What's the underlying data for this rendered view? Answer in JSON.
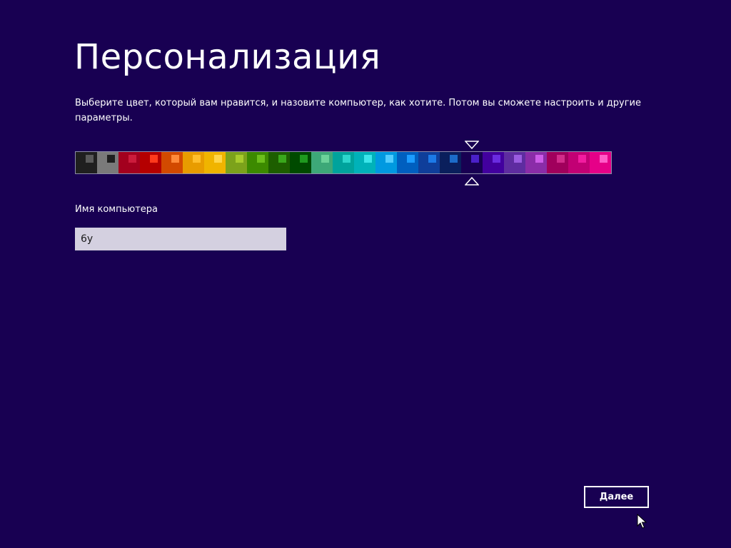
{
  "page": {
    "background": "#180052",
    "title": "Персонализация",
    "description": "Выберите цвет, который вам нравится, и назовите компьютер, как хотите. Потом вы сможете настроить и другие параметры."
  },
  "color_picker": {
    "selected_index": 18,
    "swatches": [
      {
        "bg": "#1f1f1f",
        "chip": "#5a5a5a"
      },
      {
        "bg": "#7a7a7a",
        "chip": "#1f1f1f"
      },
      {
        "bg": "#a3001e",
        "chip": "#cc1c3c"
      },
      {
        "bg": "#b50000",
        "chip": "#ff3a1c"
      },
      {
        "bg": "#d24a00",
        "chip": "#ff8a3a"
      },
      {
        "bg": "#e89c00",
        "chip": "#ffbf2c"
      },
      {
        "bg": "#f0b400",
        "chip": "#ffd64a"
      },
      {
        "bg": "#7ca21b",
        "chip": "#a8cc2c"
      },
      {
        "bg": "#3c8a00",
        "chip": "#6cbf1c"
      },
      {
        "bg": "#1d5e00",
        "chip": "#3aa81c"
      },
      {
        "bg": "#004a00",
        "chip": "#1f9a1f"
      },
      {
        "bg": "#3da878",
        "chip": "#6cd29a"
      },
      {
        "bg": "#00a39c",
        "chip": "#2cd6cc"
      },
      {
        "bg": "#00b2b9",
        "chip": "#3ce6ea"
      },
      {
        "bg": "#0099e0",
        "chip": "#52cdff"
      },
      {
        "bg": "#005fbf",
        "chip": "#1c9cff"
      },
      {
        "bg": "#0f3e9a",
        "chip": "#1c7ae8"
      },
      {
        "bg": "#0a1f5c",
        "chip": "#1c6cc8"
      },
      {
        "bg": "#180052",
        "chip": "#4a20c8"
      },
      {
        "bg": "#42009e",
        "chip": "#6a2ce0"
      },
      {
        "bg": "#5e2ca0",
        "chip": "#9a5ce0"
      },
      {
        "bg": "#8a2ca8",
        "chip": "#cc5ce8"
      },
      {
        "bg": "#a0005c",
        "chip": "#d22c8a"
      },
      {
        "bg": "#c20074",
        "chip": "#f21ca0"
      },
      {
        "bg": "#e60088",
        "chip": "#ff5cc8"
      }
    ]
  },
  "computer_name": {
    "label": "Имя компьютера",
    "value": "6у"
  },
  "footer": {
    "next_label": "Далее"
  }
}
